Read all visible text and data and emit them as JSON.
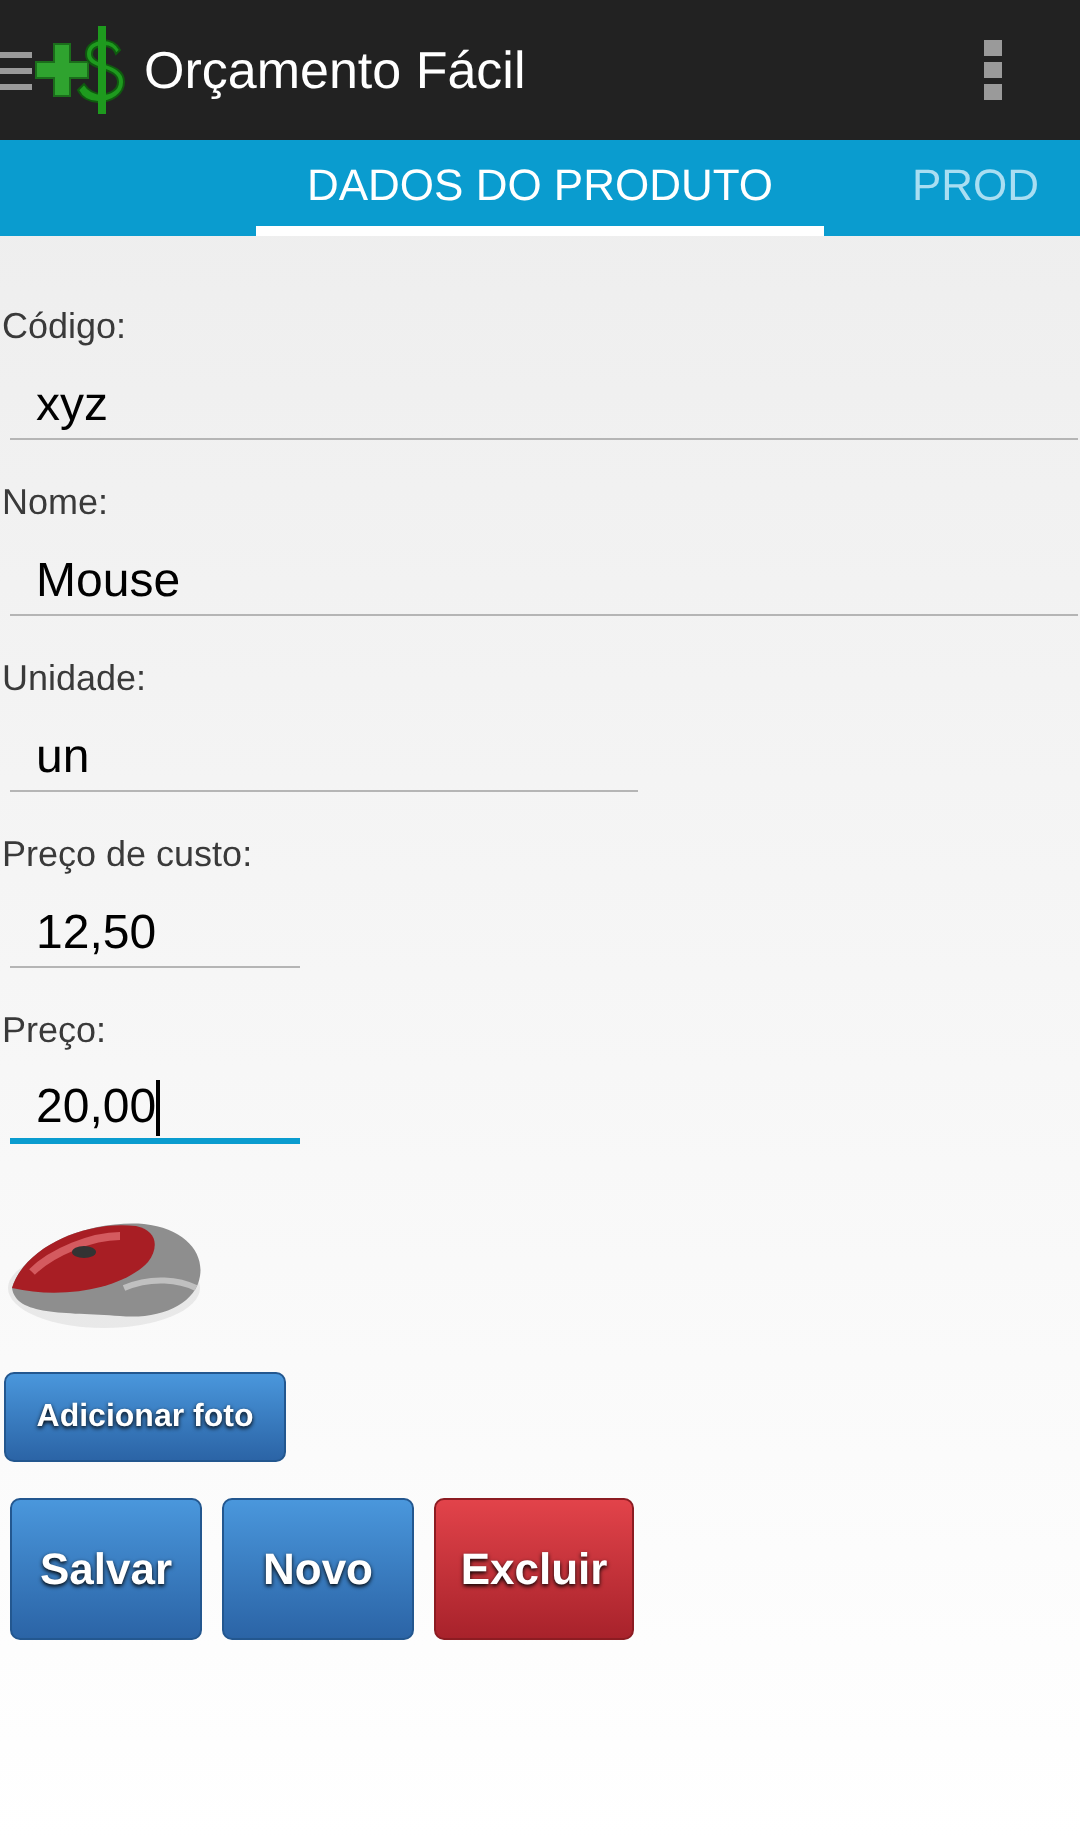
{
  "app_bar": {
    "title": "Orçamento Fácil"
  },
  "tabs": [
    {
      "label": "DADOS DO PRODUTO",
      "selected": true
    },
    {
      "label": "PROD",
      "selected": false
    }
  ],
  "fields": [
    {
      "label": "Código:",
      "value": "xyz",
      "kind": "full",
      "focused": false
    },
    {
      "label": "Nome:",
      "value": "Mouse",
      "kind": "full",
      "focused": false
    },
    {
      "label": "Unidade:",
      "value": "un",
      "kind": "medium",
      "focused": false
    },
    {
      "label": "Preço de custo:",
      "value": "12,50",
      "kind": "short",
      "focused": false
    },
    {
      "label": "Preço:",
      "value": "20,00",
      "kind": "short",
      "focused": true
    }
  ],
  "add_photo_button": "Adicionar foto",
  "buttons": [
    {
      "label": "Salvar",
      "kind": "primary"
    },
    {
      "label": "Novo",
      "kind": "primary"
    },
    {
      "label": "Excluir",
      "kind": "danger"
    }
  ]
}
